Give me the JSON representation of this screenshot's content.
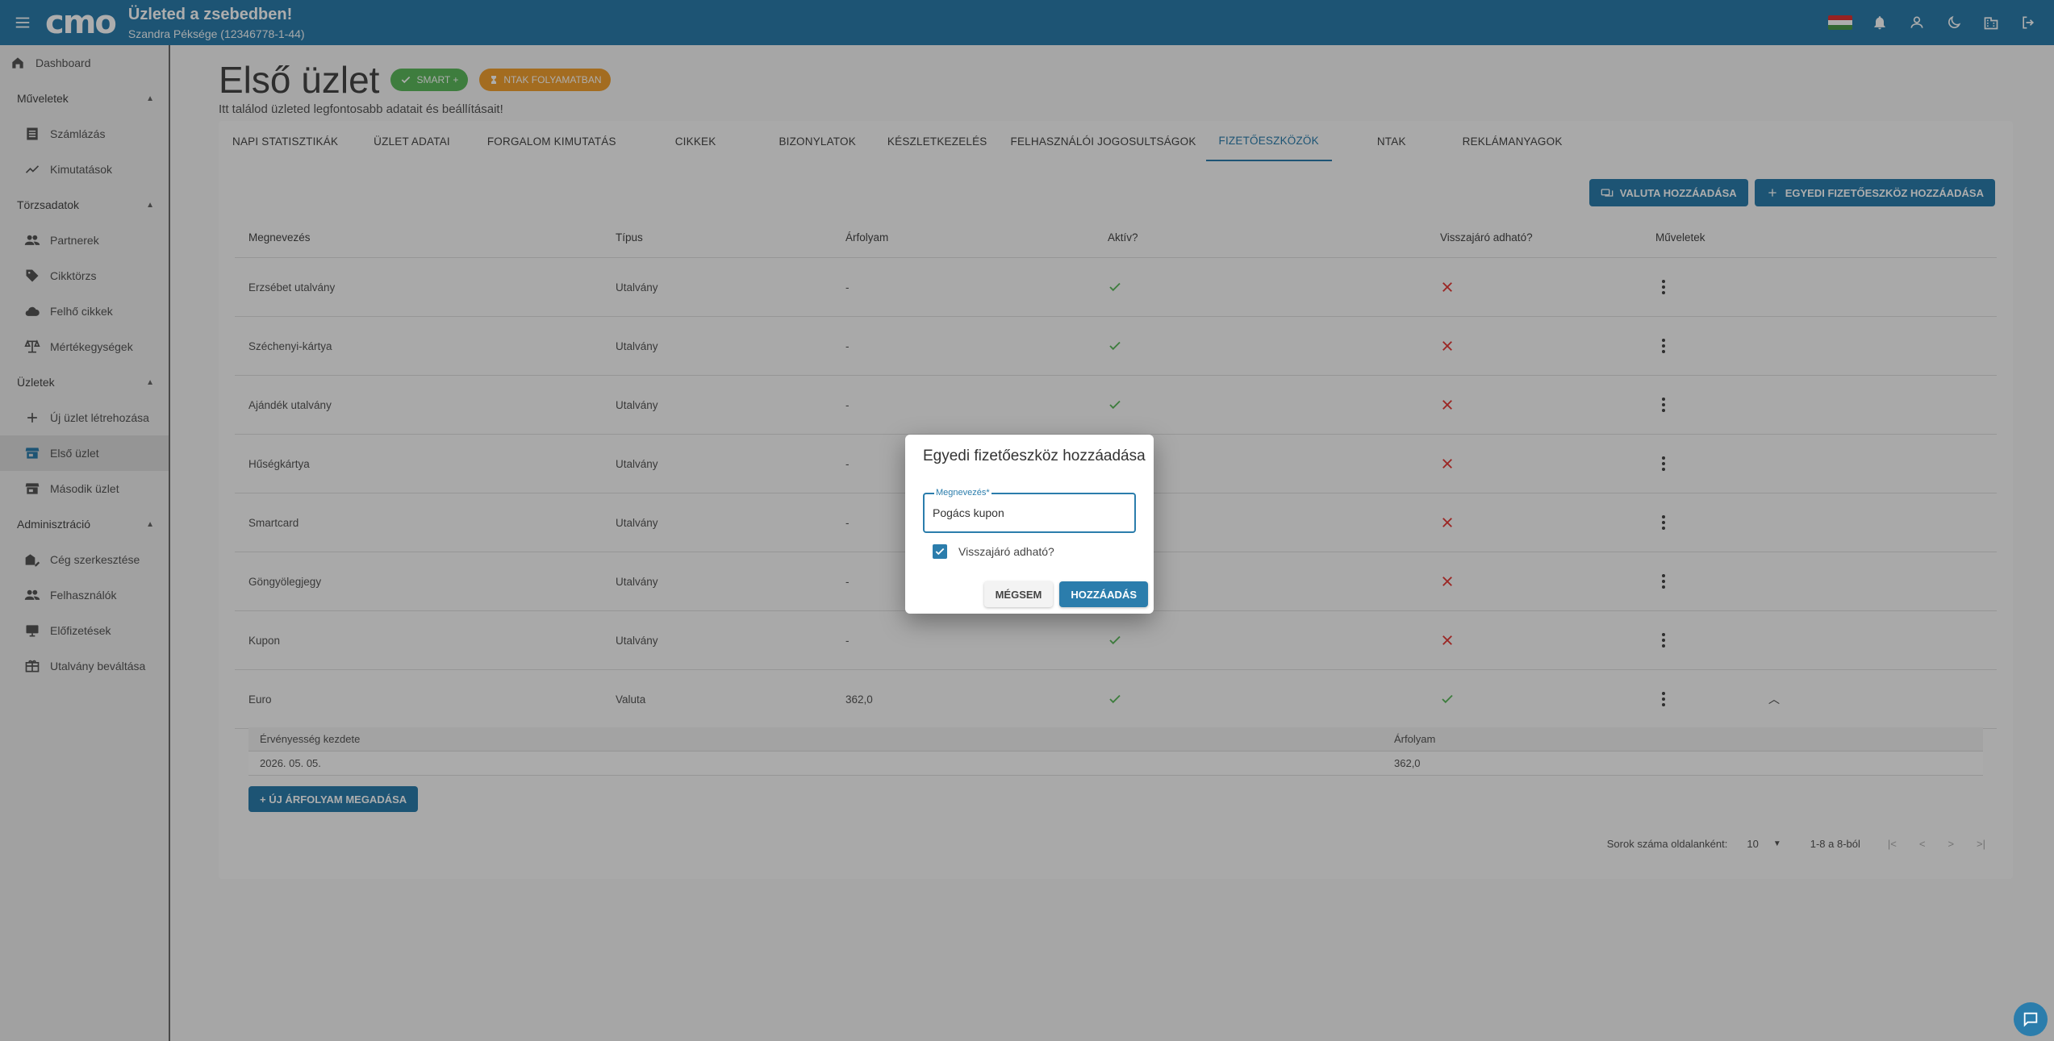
{
  "header": {
    "logo": "cmo",
    "title": "Üzleted a zsebedben!",
    "subtitle": "Szandra Péksége (12346778-1-44)"
  },
  "sidebar": {
    "dashboard": "Dashboard",
    "sections": [
      {
        "title": "Műveletek",
        "items": [
          "Számlázás",
          "Kimutatások"
        ]
      },
      {
        "title": "Törzsadatok",
        "items": [
          "Partnerek",
          "Cikktörzs",
          "Felhő cikkek",
          "Mértékegységek"
        ]
      },
      {
        "title": "Üzletek",
        "items": [
          "Új üzlet létrehozása",
          "Első üzlet",
          "Második üzlet"
        ]
      },
      {
        "title": "Adminisztráció",
        "items": [
          "Cég szerkesztése",
          "Felhasználók",
          "Előfizetések",
          "Utalvány beváltása"
        ]
      }
    ]
  },
  "page": {
    "title": "Első üzlet",
    "chip_smart": "SMART +",
    "chip_ntak": "NTAK FOLYAMATBAN",
    "subtitle": "Itt találod üzleted legfontosabb adatait és beállításait!"
  },
  "tabs": [
    "NAPI STATISZTIKÁK",
    "ÜZLET ADATAI",
    "FORGALOM KIMUTATÁS",
    "CIKKEK",
    "BIZONYLATOK",
    "KÉSZLETKEZELÉS",
    "FELHASZNÁLÓI JOGOSULTSÁGOK",
    "FIZETŐESZKÖZÖK",
    "NTAK",
    "REKLÁMANYAGOK"
  ],
  "actions": {
    "add_currency": "VALUTA HOZZÁADÁSA",
    "add_custom": "EGYEDI FIZETŐESZKÖZ HOZZÁADÁSA"
  },
  "table": {
    "headers": [
      "Megnevezés",
      "Típus",
      "Árfolyam",
      "Aktív?",
      "Visszajáró adható?",
      "Műveletek"
    ],
    "rows": [
      {
        "name": "Erzsébet utalvány",
        "type": "Utalvány",
        "rate": "-",
        "active": true,
        "change": false
      },
      {
        "name": "Széchenyi-kártya",
        "type": "Utalvány",
        "rate": "-",
        "active": true,
        "change": false
      },
      {
        "name": "Ajándék utalvány",
        "type": "Utalvány",
        "rate": "-",
        "active": true,
        "change": false
      },
      {
        "name": "Hűségkártya",
        "type": "Utalvány",
        "rate": "-",
        "active": true,
        "change": false
      },
      {
        "name": "Smartcard",
        "type": "Utalvány",
        "rate": "-",
        "active": true,
        "change": false
      },
      {
        "name": "Göngyölegjegy",
        "type": "Utalvány",
        "rate": "-",
        "active": true,
        "change": false
      },
      {
        "name": "Kupon",
        "type": "Utalvány",
        "rate": "-",
        "active": true,
        "change": false
      },
      {
        "name": "Euro",
        "type": "Valuta",
        "rate": "362,0",
        "active": true,
        "change": true
      }
    ]
  },
  "subtable": {
    "headers": [
      "Érvényesség kezdete",
      "Árfolyam"
    ],
    "row": [
      "2026. 05. 05.",
      "362,0"
    ],
    "new_rate_button": "+ ÚJ ÁRFOLYAM MEGADÁSA"
  },
  "pager": {
    "rows_label": "Sorok száma oldalanként:",
    "rows_value": "10",
    "range": "1-8 a 8-ból"
  },
  "dialog": {
    "title": "Egyedi fizetőeszköz hozzáadása",
    "field_label": "Megnevezés*",
    "field_value": "Pogács kupon",
    "checkbox_label": "Visszajáró adható?",
    "cancel": "MÉGSEM",
    "submit": "HOZZÁADÁS"
  },
  "colors": {
    "primary": "#2b7dac",
    "success": "#5cb85c",
    "warning": "#f0a030",
    "error": "#e53935"
  }
}
